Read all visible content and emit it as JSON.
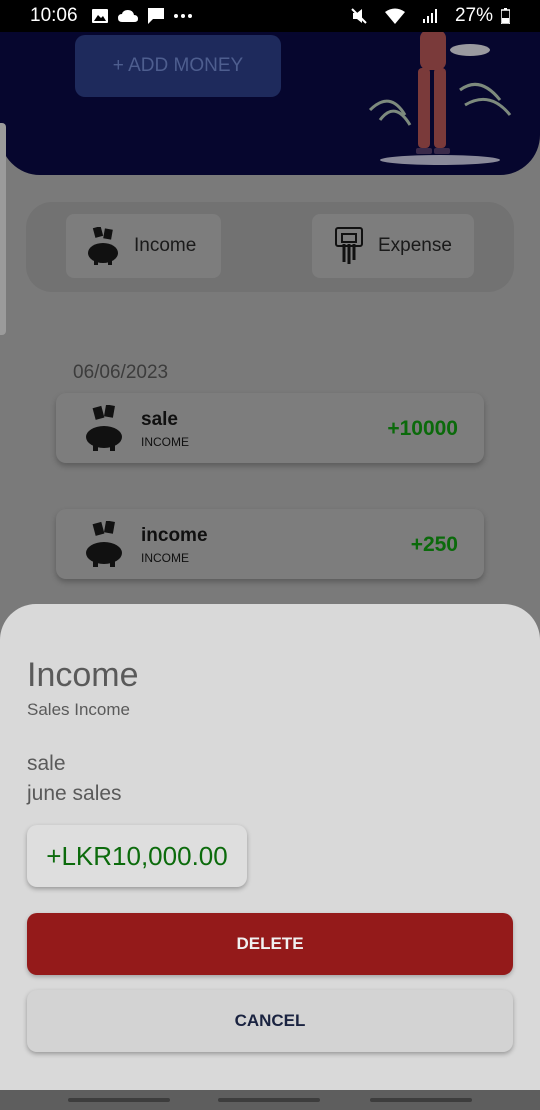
{
  "status_bar": {
    "time": "10:06",
    "battery": "27%",
    "icons": [
      "image-icon",
      "cloud-icon",
      "message-icon",
      "more-icon",
      "mute-icon",
      "wifi-icon",
      "signal-icon",
      "battery-icon"
    ]
  },
  "hero": {
    "add_money_label": "+ ADD MONEY"
  },
  "toggle": {
    "income_label": "Income",
    "expense_label": "Expense"
  },
  "transactions": {
    "date": "06/06/2023",
    "items": [
      {
        "title": "sale",
        "type": "INCOME",
        "amount": "+10000"
      },
      {
        "title": "income",
        "type": "INCOME",
        "amount": "+250"
      }
    ]
  },
  "sheet": {
    "title": "Income",
    "subtitle": "Sales Income",
    "name": "sale",
    "note": "june sales",
    "amount": "+LKR10,000.00",
    "delete_label": "DELETE",
    "cancel_label": "CANCEL"
  },
  "colors": {
    "hero_bg": "#06062e",
    "income_green": "#0c6b0c",
    "delete_red": "#941a1a"
  }
}
